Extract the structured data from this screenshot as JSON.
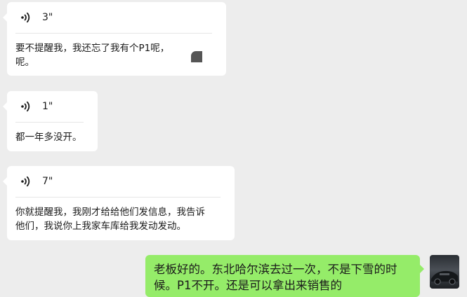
{
  "messages": [
    {
      "type": "voice",
      "direction": "incoming",
      "duration": "3\"",
      "transcript": "要不提醒我，我还忘了我有个P1呢，\n呢。",
      "icon": "voice-wave-icon"
    },
    {
      "type": "voice",
      "direction": "incoming",
      "duration": "1\"",
      "transcript": "都一年多没开。",
      "icon": "voice-wave-icon"
    },
    {
      "type": "voice",
      "direction": "incoming",
      "duration": "7\"",
      "transcript": "你就提醒我，我刚才给给他们发信息，我告诉\n他们，我说你上我家车库给我发动发动。",
      "icon": "voice-wave-icon"
    },
    {
      "type": "text",
      "direction": "outgoing",
      "text": "老板好的。东北哈尔滨去过一次，不是下雪的时候。P1不开。还是可以拿出来销售的"
    }
  ],
  "colors": {
    "background": "#ededed",
    "incoming_bubble": "#ffffff",
    "outgoing_bubble": "#95ec69"
  }
}
